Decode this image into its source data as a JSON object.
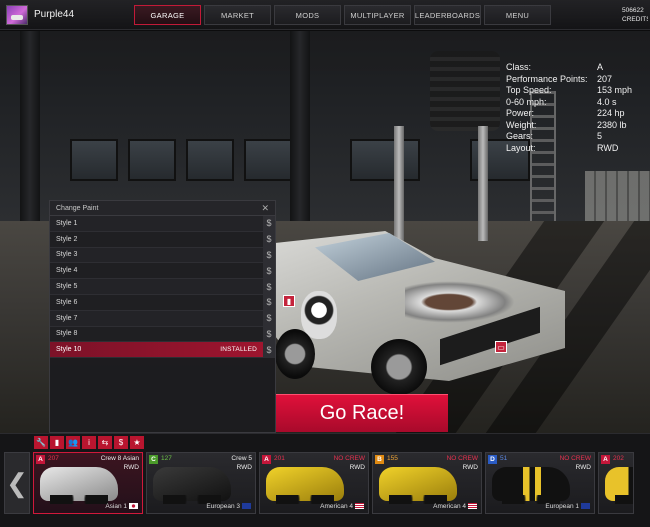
{
  "topbar": {
    "username": "Purple44",
    "nav": [
      "GARAGE",
      "MARKET",
      "MODS",
      "MULTIPLAYER",
      "LEADERBOARDS",
      "MENU"
    ],
    "active_nav": "GARAGE",
    "credits_value": "506622",
    "credits_label": "CREDITS"
  },
  "stats": [
    {
      "label": "Class:",
      "value": "A"
    },
    {
      "label": "Performance Points:",
      "value": "207"
    },
    {
      "label": "Top Speed:",
      "value": "153 mph"
    },
    {
      "label": "0-60 mph:",
      "value": "4.0 s"
    },
    {
      "label": "Power:",
      "value": "224 hp"
    },
    {
      "label": "Weight:",
      "value": "2380 lb"
    },
    {
      "label": "Gears:",
      "value": "5"
    },
    {
      "label": "Layout:",
      "value": "RWD"
    }
  ],
  "paint_panel": {
    "title": "Change Paint",
    "close": "✕",
    "price_symbol": "$",
    "installed_label": "INSTALLED",
    "styles": [
      "Style 1",
      "Style 2",
      "Style 3",
      "Style 4",
      "Style 5",
      "Style 6",
      "Style 7",
      "Style 8",
      "Style 10"
    ],
    "installed_style": "Style 10"
  },
  "go_race": "Go Race!",
  "toolbar_icons": [
    "wrench-icon",
    "paint-bucket-icon",
    "crew-icon",
    "info-icon",
    "car-icon",
    "dollar-icon",
    "star-icon"
  ],
  "toolbar_glyphs": [
    "🔧",
    "▮",
    "👥",
    "i",
    "⇆",
    "$",
    "★"
  ],
  "left_arrow": "❮",
  "cars": [
    {
      "class": "A",
      "pp": "207",
      "crew": "Crew 8 Asian",
      "drive": "RWD",
      "region": "Asian 1",
      "selected": true
    },
    {
      "class": "C",
      "pp": "127",
      "crew": "Crew 5",
      "drive": "RWD",
      "region": "European 3",
      "selected": false
    },
    {
      "class": "A",
      "pp": "201",
      "crew": "NO CREW",
      "drive": "RWD",
      "region": "American 4",
      "selected": false
    },
    {
      "class": "B",
      "pp": "155",
      "crew": "NO CREW",
      "drive": "RWD",
      "region": "American 4",
      "selected": false
    },
    {
      "class": "D",
      "pp": "51",
      "crew": "NO CREW",
      "drive": "RWD",
      "region": "European 1",
      "selected": false
    },
    {
      "class": "A",
      "pp": "202",
      "crew": "",
      "drive": "",
      "region": "",
      "selected": false
    }
  ],
  "colors": {
    "accent": "#c4163a",
    "class_A": "#c4163a",
    "class_B": "#e08a12",
    "class_C": "#4a9a2a",
    "class_D": "#2a5bc4",
    "no_crew": "#d01a3a"
  }
}
